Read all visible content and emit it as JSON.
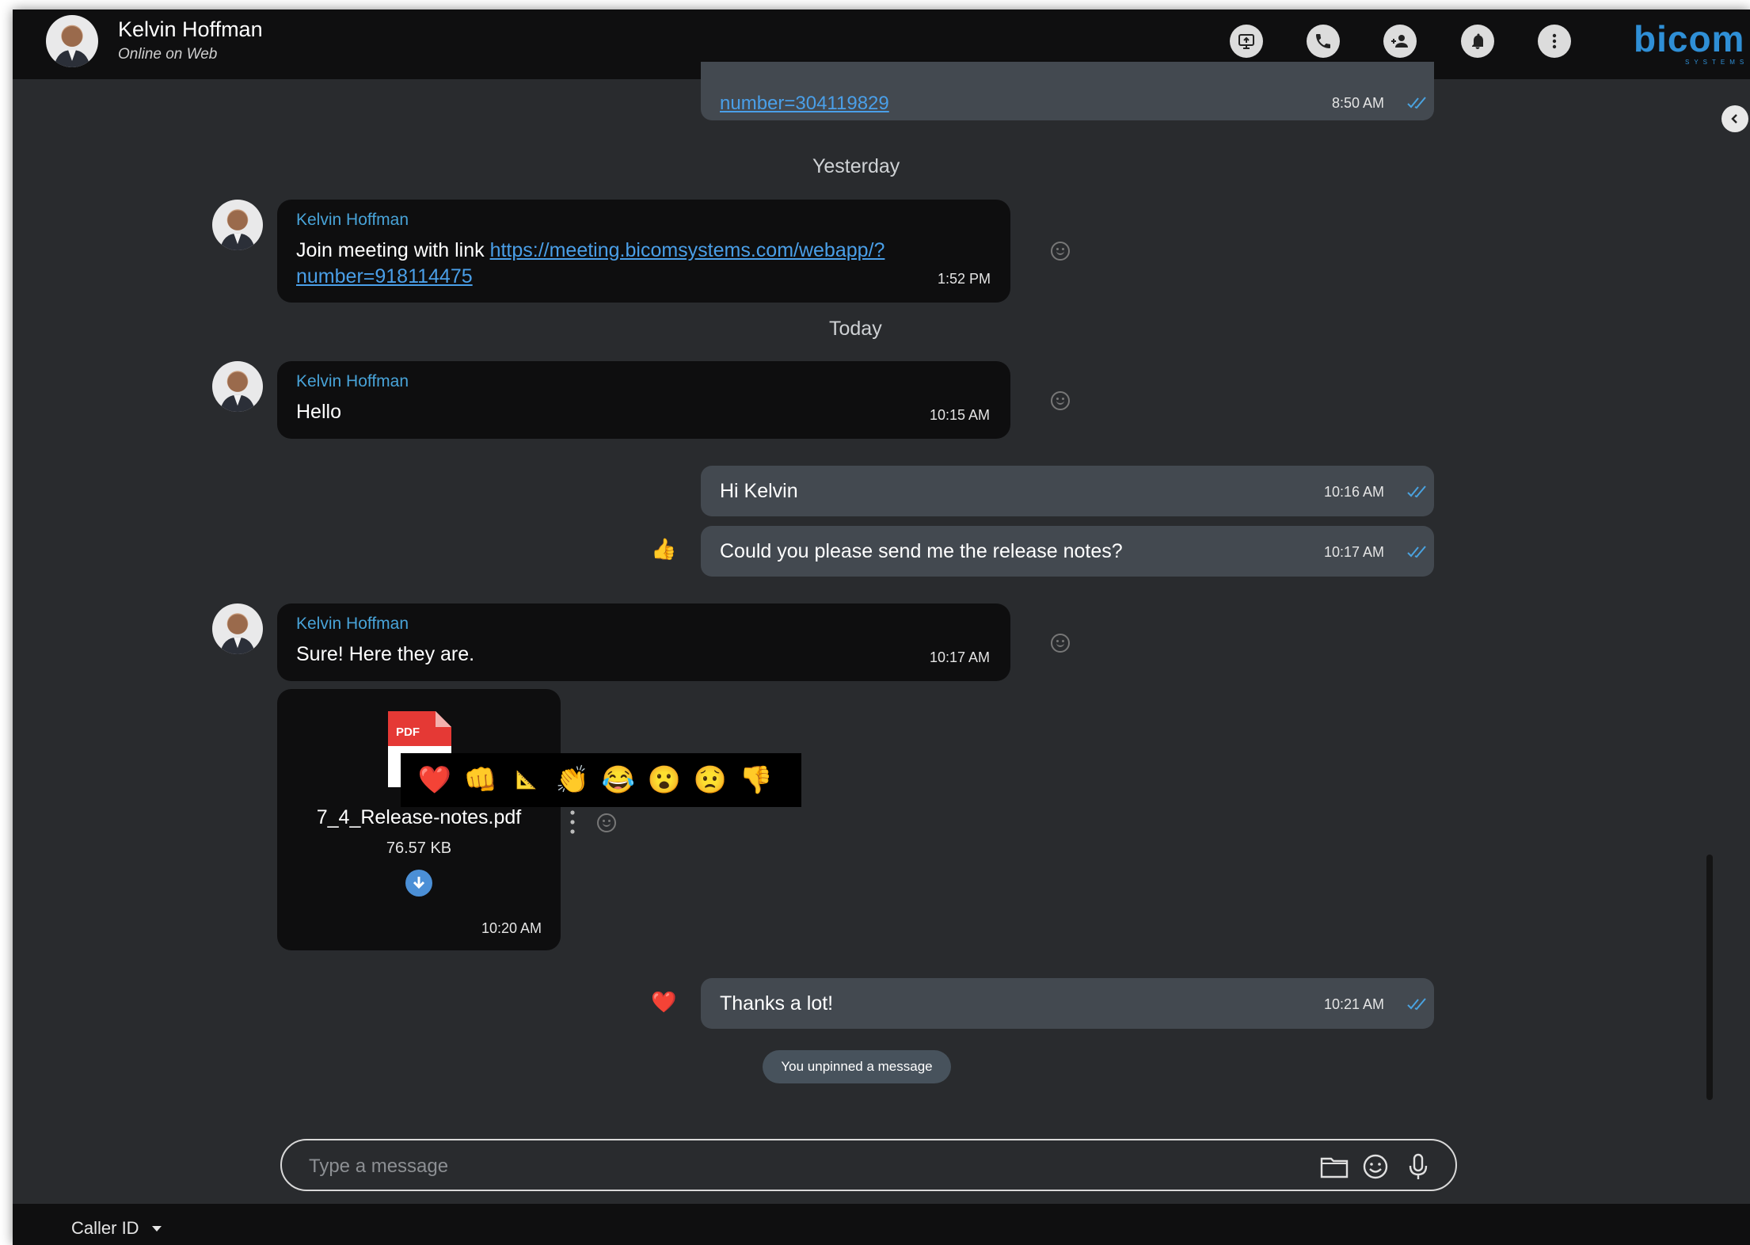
{
  "header": {
    "contact_name": "Kelvin Hoffman",
    "status": "Online on Web",
    "buttons": [
      "screen-share-icon",
      "phone-icon",
      "add-user-icon",
      "bell-icon",
      "more-vertical-icon"
    ],
    "brand": "bicom",
    "brand_sub": "SYSTEMS"
  },
  "colors": {
    "accent": "#48a3d8",
    "link": "#4a9fe8",
    "outgoing": "#434950",
    "incoming": "#0e0e0f",
    "background": "#292b2e"
  },
  "messages": {
    "top_partial": {
      "link": "number=304119829",
      "time": "8:50 AM"
    },
    "day_yesterday": "Yesterday",
    "m1": {
      "sender": "Kelvin Hoffman",
      "prefix": "Join meeting with link ",
      "link1": "https://meeting.bicomsystems.com/webapp/?",
      "link2": "number=918114475",
      "time": "1:52 PM"
    },
    "day_today": "Today",
    "m2": {
      "sender": "Kelvin Hoffman",
      "text": "Hello",
      "time": "10:15 AM"
    },
    "m3": {
      "text": "Hi Kelvin",
      "time": "10:16 AM"
    },
    "m4": {
      "text": "Could you please send me the release notes?",
      "time": "10:17 AM",
      "reaction": "👍"
    },
    "m5": {
      "sender": "Kelvin Hoffman",
      "text": "Sure! Here they are.",
      "time": "10:17 AM"
    },
    "file": {
      "icon_label": "PDF",
      "name": "7_4_Release-notes.pdf",
      "size": "76.57 KB",
      "time": "10:20 AM"
    },
    "m6": {
      "text": "Thanks a lot!",
      "time": "10:21 AM",
      "reaction": "❤️"
    },
    "system_pill": "You unpinned a message"
  },
  "emoji_picker": [
    "❤️",
    "👊",
    "📐",
    "👏",
    "😂",
    "😮",
    "😟",
    "👎"
  ],
  "composer": {
    "placeholder": "Type a message"
  },
  "footer": {
    "caller_id": "Caller ID"
  }
}
